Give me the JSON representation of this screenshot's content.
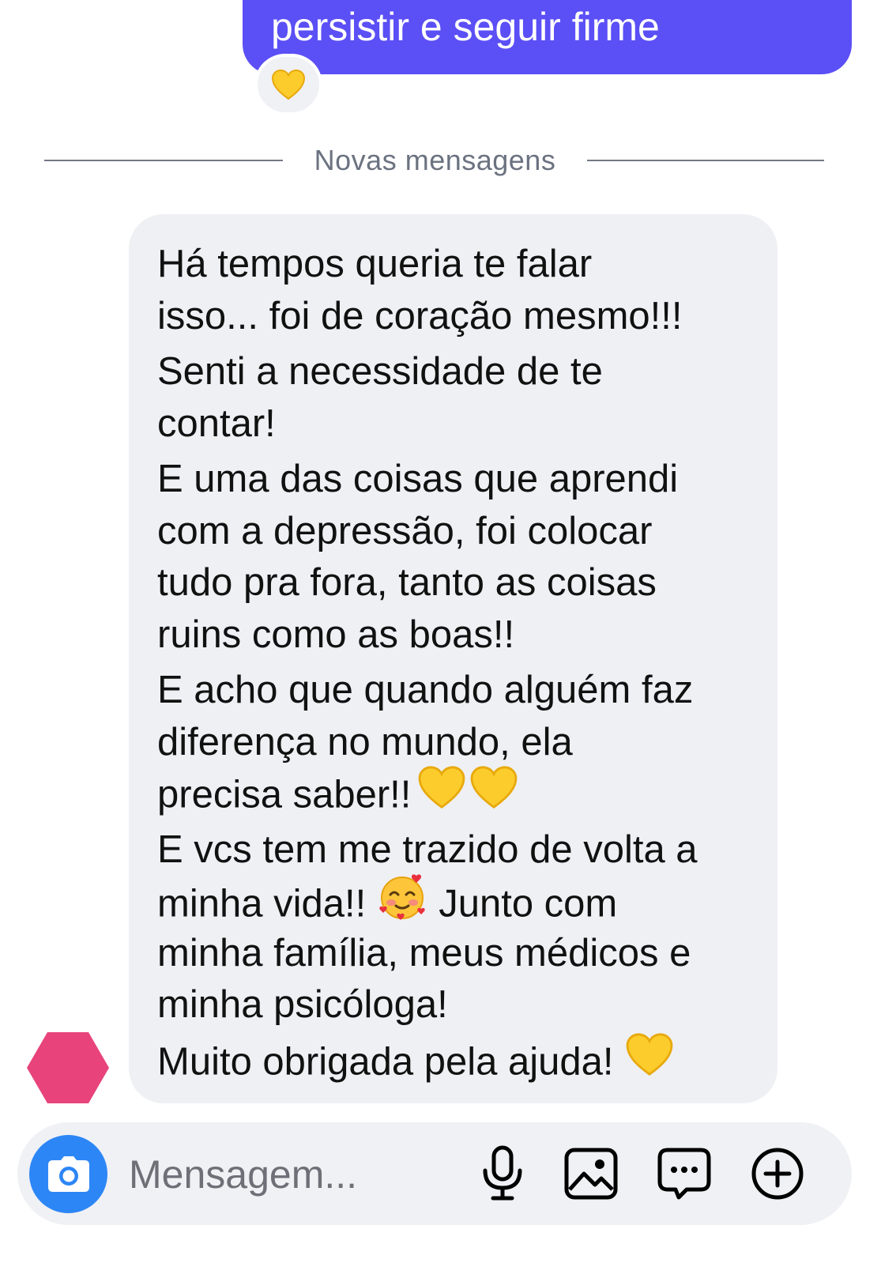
{
  "colors": {
    "sent_bubble": "#5b4ff6",
    "received_bubble": "#eff0f4",
    "camera_button": "#2d86f6",
    "avatar": "#e8437a",
    "divider": "#737985"
  },
  "sent_message": {
    "text": "persistir e seguir firme",
    "reaction_icon": "yellow-heart-icon"
  },
  "divider": {
    "label": "Novas mensagens"
  },
  "received_message": {
    "lines": [
      "Há tempos queria te falar",
      "isso... foi de coração mesmo!!!",
      "Senti a necessidade de te",
      "contar!",
      "E uma das coisas que aprendi",
      "com a depressão, foi colocar",
      "tudo pra fora, tanto as coisas",
      "ruins como as boas!!",
      "E acho que quando alguém faz",
      "diferença no mundo, ela",
      "precisa saber!!",
      "E vcs tem me trazido de volta a",
      "minha vida!!",
      "Junto com",
      "minha família, meus médicos e",
      "minha psicóloga!",
      "Muito obrigada pela ajuda!"
    ],
    "emojis": {
      "yellow_heart": "yellow-heart-icon",
      "smiling_hearts": "smiling-face-with-hearts-icon"
    }
  },
  "composer": {
    "placeholder": "Mensagem...",
    "camera_icon": "camera-icon",
    "tools": [
      "microphone-icon",
      "image-icon",
      "sticker-icon",
      "plus-icon"
    ]
  }
}
